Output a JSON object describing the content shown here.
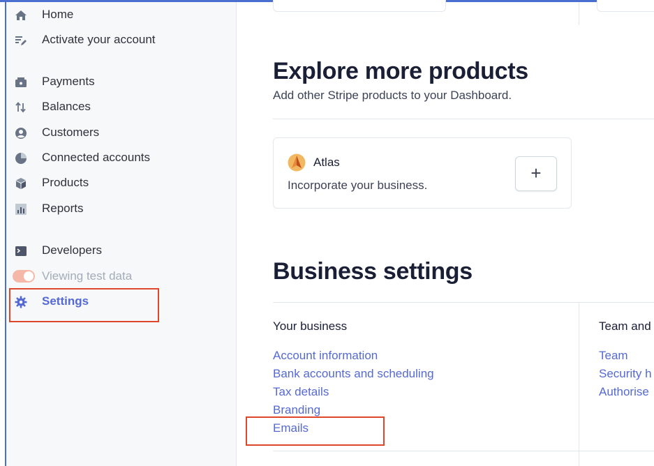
{
  "sidebar": {
    "items": [
      {
        "label": "Home",
        "icon": "home-icon"
      },
      {
        "label": "Activate your account",
        "icon": "edit-list-icon"
      },
      {
        "label": "Payments",
        "icon": "wallet-icon"
      },
      {
        "label": "Balances",
        "icon": "arrows-up-down-icon"
      },
      {
        "label": "Customers",
        "icon": "user-circle-icon"
      },
      {
        "label": "Connected accounts",
        "icon": "pie-icon"
      },
      {
        "label": "Products",
        "icon": "box-icon"
      },
      {
        "label": "Reports",
        "icon": "bar-report-icon"
      },
      {
        "label": "Developers",
        "icon": "terminal-icon"
      }
    ],
    "test_toggle_label": "Viewing test data",
    "settings_label": "Settings"
  },
  "main": {
    "explore_title": "Explore more products",
    "explore_subtitle": "Add other Stripe products to your Dashboard.",
    "product": {
      "name": "Atlas",
      "description": "Incorporate your business.",
      "add_label": "+"
    },
    "business_title": "Business settings",
    "your_business": {
      "title": "Your business",
      "links": [
        "Account information",
        "Bank accounts and scheduling",
        "Tax details",
        "Branding",
        "Emails"
      ]
    },
    "team": {
      "title": "Team and",
      "links": [
        "Team",
        "Security h",
        "Authorise"
      ]
    }
  },
  "colors": {
    "accent": "#5469d4",
    "highlight": "#e0462a",
    "toggle": "#f5b8a8"
  }
}
